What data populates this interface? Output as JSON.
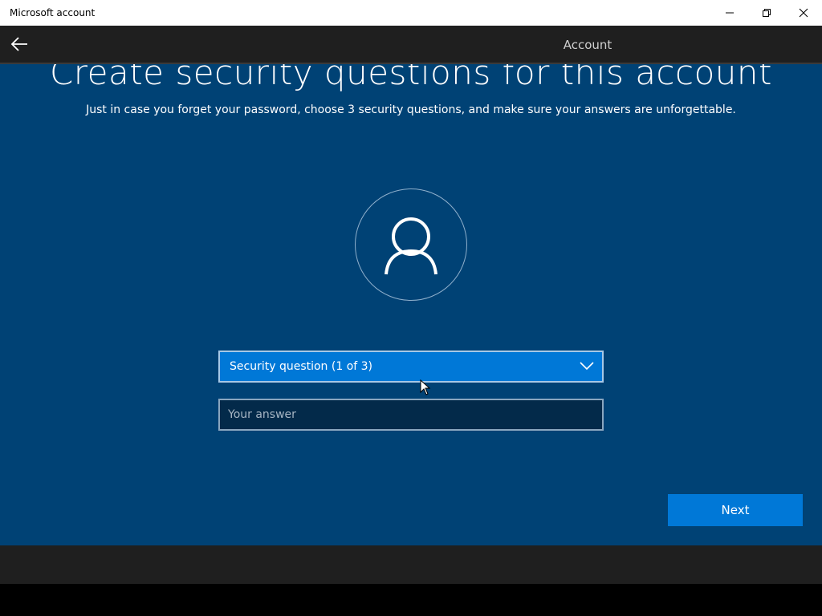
{
  "window": {
    "title": "Microsoft account",
    "controls": {
      "minimize": "minimize-icon",
      "restore": "restore-icon",
      "close": "close-icon"
    }
  },
  "header": {
    "back_icon": "back-arrow-icon",
    "tab_label": "Account"
  },
  "main": {
    "title": "Create security questions for this account",
    "subtitle": "Just in case you forget your password, choose 3 security questions, and make sure your answers are unforgettable.",
    "avatar_icon": "user-icon",
    "question_dropdown": {
      "selected": "Security question (1 of 3)"
    },
    "answer_field": {
      "placeholder": "Your answer",
      "value": ""
    },
    "next_label": "Next"
  },
  "colors": {
    "background": "#004275",
    "accent": "#0078d7",
    "header": "#1f1f1f"
  }
}
